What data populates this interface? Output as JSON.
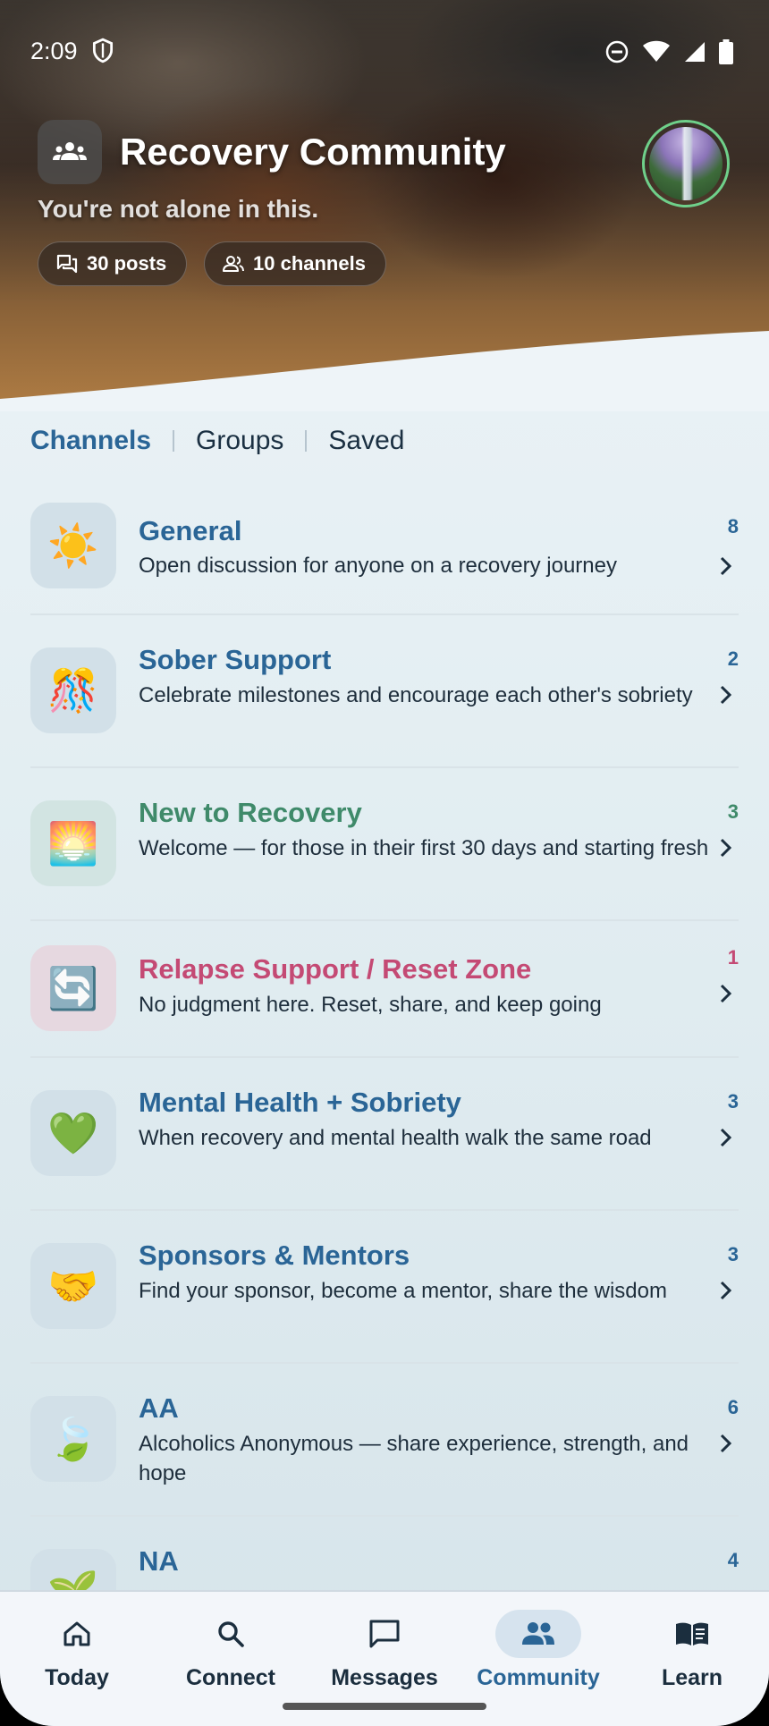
{
  "status_bar": {
    "time": "2:09"
  },
  "header": {
    "title": "Recovery Community",
    "subtitle": "You're not alone in this.",
    "posts_chip": "30 posts",
    "channels_chip": "10 channels"
  },
  "tabs": [
    {
      "label": "Channels",
      "active": true
    },
    {
      "label": "Groups",
      "active": false
    },
    {
      "label": "Saved",
      "active": false
    }
  ],
  "channels": [
    {
      "title": "General",
      "description": "Open discussion for anyone on a recovery journey",
      "count": "8",
      "icon": "☀️",
      "color": "#2a6596",
      "icon_bg": "#d2e0e8"
    },
    {
      "title": "Sober Support",
      "description": "Celebrate milestones and encourage each other's sobriety",
      "count": "2",
      "icon": "🎊",
      "color": "#2a6596",
      "icon_bg": "#d2e0e8"
    },
    {
      "title": "New to Recovery",
      "description": "Welcome — for those in their first 30 days and starting fresh",
      "count": "3",
      "icon": "🌅",
      "color": "#3f8a6a",
      "icon_bg": "#d2e4e2"
    },
    {
      "title": "Relapse Support / Reset Zone",
      "description": "No judgment here. Reset, share, and keep going",
      "count": "1",
      "icon": "🔄",
      "color": "#c44a74",
      "icon_bg": "#e6d8e0"
    },
    {
      "title": "Mental Health + Sobriety",
      "description": "When recovery and mental health walk the same road",
      "count": "3",
      "icon": "💚",
      "color": "#2a6596",
      "icon_bg": "#d2e0e8"
    },
    {
      "title": "Sponsors & Mentors",
      "description": "Find your sponsor, become a mentor, share the wisdom",
      "count": "3",
      "icon": "🤝",
      "color": "#2a6596",
      "icon_bg": "#d2e0e8"
    },
    {
      "title": "AA",
      "description": "Alcoholics Anonymous — share experience, strength, and hope",
      "count": "6",
      "icon": "🍃",
      "color": "#2a6596",
      "icon_bg": "#d2e0e8"
    },
    {
      "title": "NA",
      "description": "",
      "count": "4",
      "icon": "🌱",
      "color": "#2a6596",
      "icon_bg": "#d2e0e8"
    }
  ],
  "nav": [
    {
      "label": "Today",
      "icon": "home-icon",
      "active": false
    },
    {
      "label": "Connect",
      "icon": "search-icon",
      "active": false
    },
    {
      "label": "Messages",
      "icon": "chat-icon",
      "active": false
    },
    {
      "label": "Community",
      "icon": "people-icon",
      "active": true
    },
    {
      "label": "Learn",
      "icon": "book-icon",
      "active": false
    }
  ]
}
